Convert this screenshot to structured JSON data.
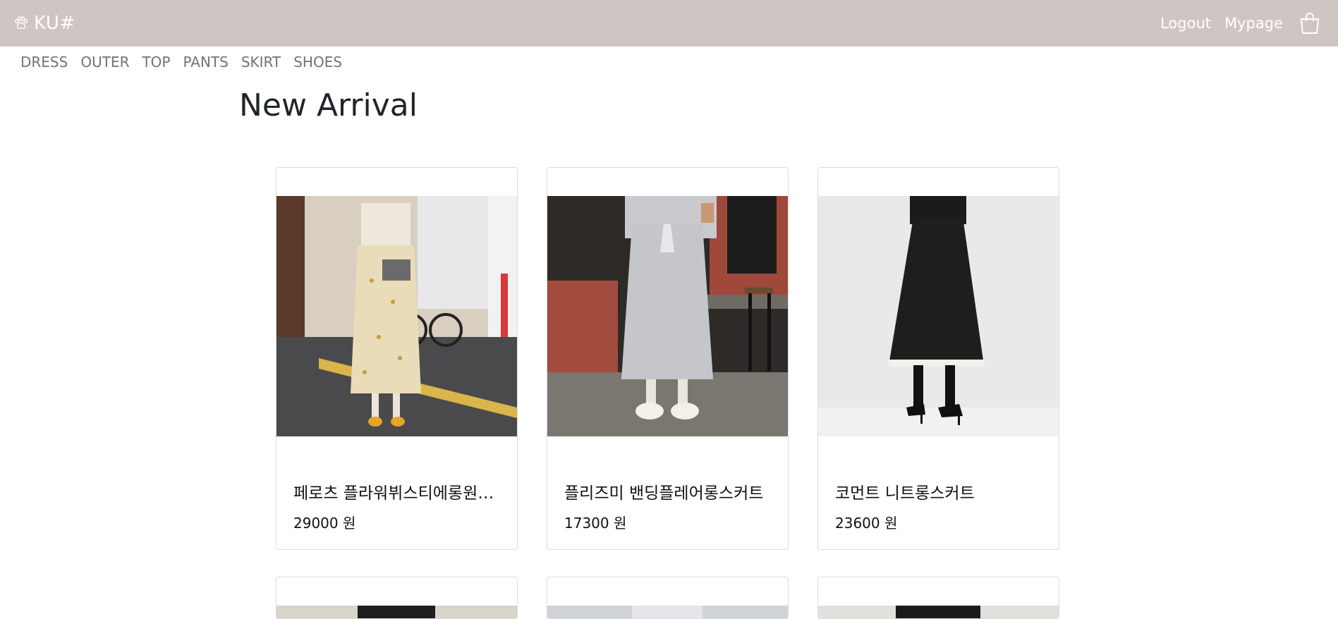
{
  "header": {
    "brand": "KU#",
    "brand_icon": "paw-icon",
    "logout": "Logout",
    "mypage": "Mypage",
    "cart_icon": "shopping-bag-icon"
  },
  "categories": [
    "DRESS",
    "OUTER",
    "TOP",
    "PANTS",
    "SKIRT",
    "SHOES"
  ],
  "main": {
    "title": "New Arrival",
    "products": [
      {
        "name": "페로츠 플라워뷔스티에롱원피스",
        "price": "29000 원"
      },
      {
        "name": "플리즈미 밴딩플레어롱스커트",
        "price": "17300 원"
      },
      {
        "name": "코먼트 니트롱스커트",
        "price": "23600 원"
      }
    ]
  },
  "colors": {
    "header_bg": "#cfc6c3",
    "header_text": "#ffffff",
    "nav_text": "#6c757d"
  }
}
